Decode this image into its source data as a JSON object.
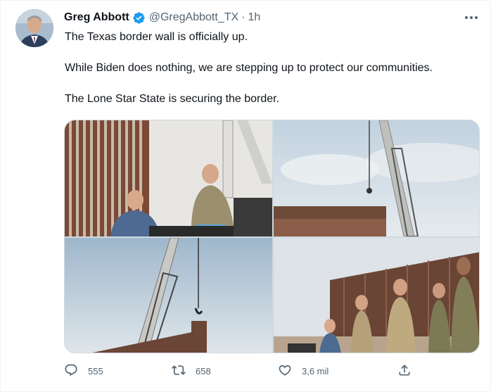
{
  "tweet": {
    "author_name": "Greg Abbott",
    "handle": "@GregAbbott_TX",
    "separator": "·",
    "time": "1h",
    "text_lines": [
      "The Texas border wall is officially up.",
      "While Biden does nothing, we are stepping up to protect our communities.",
      "The Lone Star State is securing the border."
    ],
    "verified_color": "#1d9bf0"
  },
  "actions": {
    "reply_count": "555",
    "retweet_count": "658",
    "like_count": "3,6 mil"
  },
  "icons": {
    "verified": "verified-badge-icon",
    "more": "more-options-icon",
    "reply": "reply-icon",
    "retweet": "retweet-icon",
    "like": "like-heart-icon",
    "share": "share-icon"
  },
  "colors": {
    "text_primary": "#0f1419",
    "text_secondary": "#536471",
    "border": "#cfd9de"
  }
}
